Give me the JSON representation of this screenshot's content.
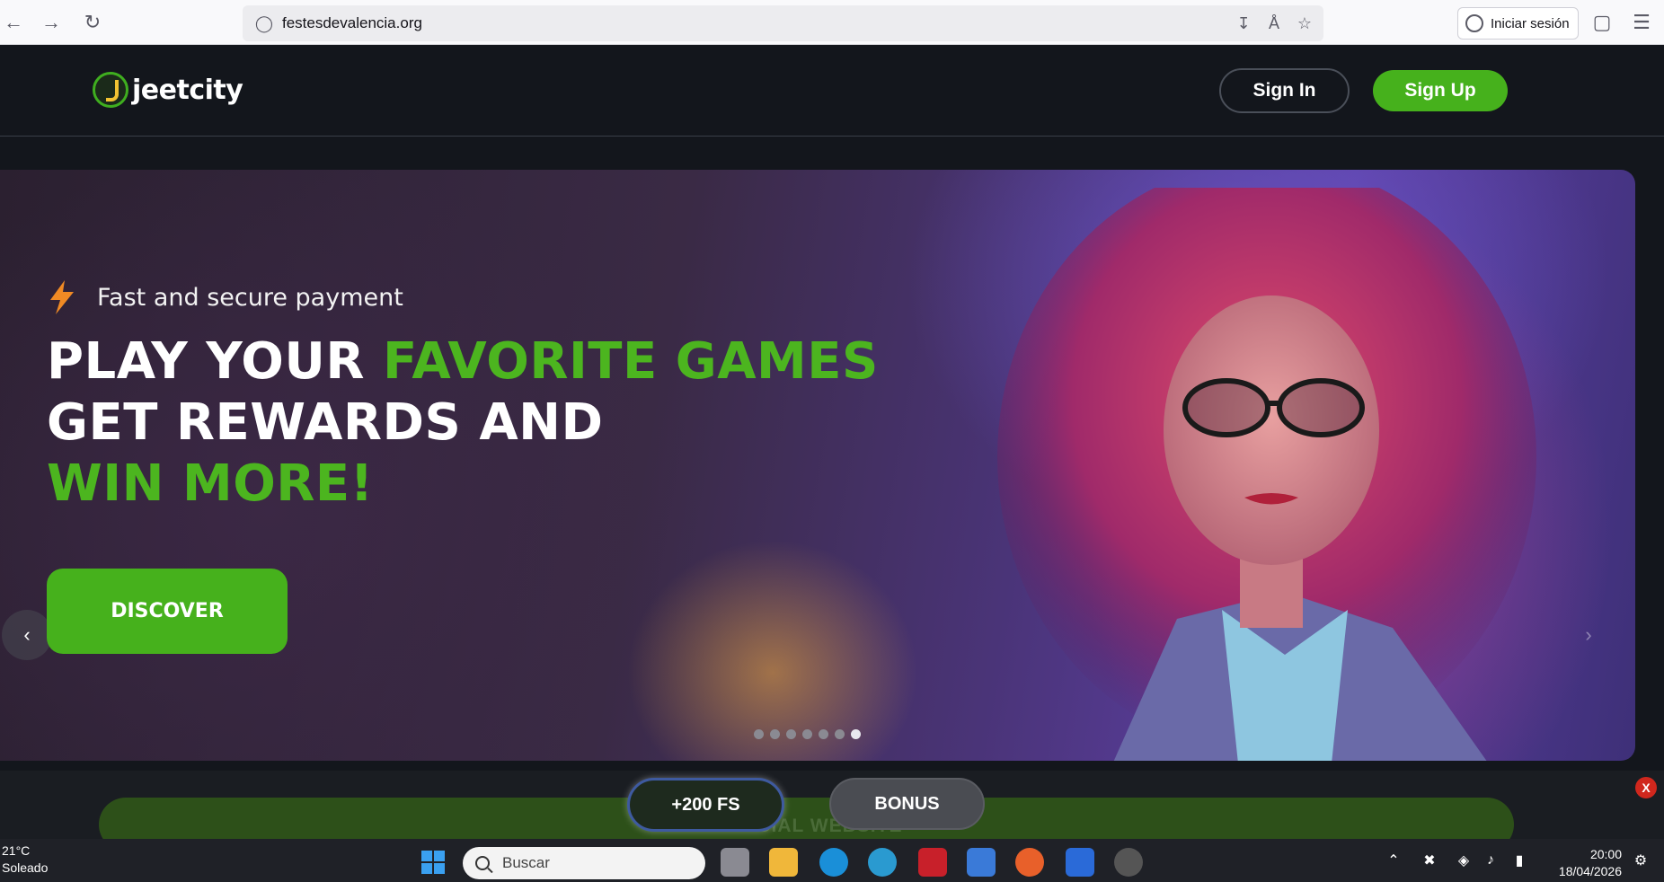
{
  "browser": {
    "url": "festesdevalencia.org",
    "signin_label": "Iniciar sesión"
  },
  "header": {
    "logo_text": "jeetcity",
    "signin_label": "Sign In",
    "signup_label": "Sign Up"
  },
  "hero": {
    "tagline": "Fast and secure payment",
    "line1_white": "PLAY YOUR ",
    "line1_green": "FAVORITE GAMES",
    "line2_white": "GET REWARDS AND",
    "line3_green": "WIN MORE!",
    "cta_label": "DISCOVER",
    "prev_arrow": "‹",
    "next_arrow": "›",
    "slide_count": 7,
    "active_slide": 7
  },
  "promo": {
    "official_text": "OFFICIAL WEBSITE",
    "fs_label": "+200 FS",
    "bonus_label": "BONUS",
    "close_label": "X"
  },
  "taskbar": {
    "temperature": "21°C",
    "weather": "Soleado",
    "search_placeholder": "Buscar",
    "time": "20:00",
    "date": "18/04/2026"
  },
  "colors": {
    "accent_green": "#46b11c",
    "header_bg": "#13161c"
  }
}
